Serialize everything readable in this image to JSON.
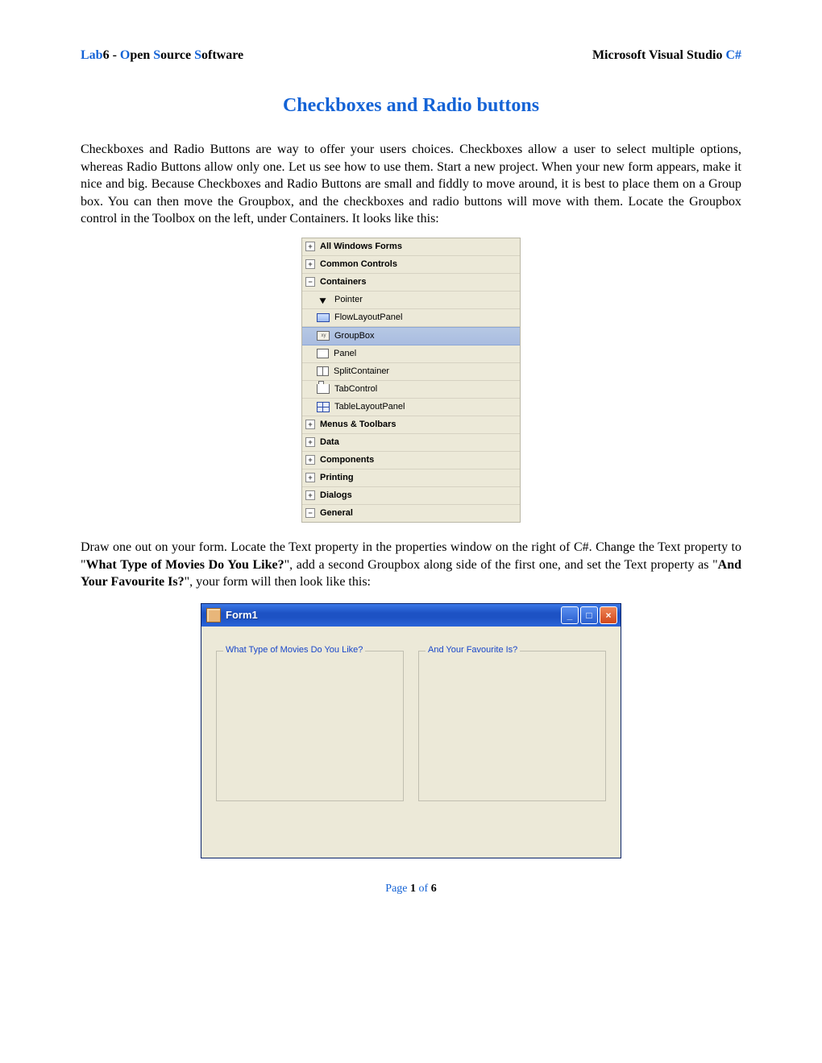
{
  "header": {
    "left_lab": "Lab",
    "left_six": "6 - ",
    "left_o": "O",
    "left_open": "pen ",
    "left_s1": "S",
    "left_source": "ource ",
    "left_s2": "S",
    "left_software": "oftware",
    "right_pre": "Microsoft Visual Studio ",
    "right_c": "C#"
  },
  "title": "Checkboxes and Radio buttons",
  "para1": "Checkboxes and Radio Buttons are way to offer your users choices. Checkboxes allow a user to select multiple options, whereas Radio Buttons allow only one. Let us see how to use them. Start a new project. When your new form appears, make it nice and big. Because Checkboxes and Radio Buttons are small and fiddly to move around, it is best to place them on a Group box. You can then move the Groupbox, and the checkboxes and radio buttons will move with them. Locate the Groupbox control in the Toolbox on the left, under Containers. It looks like this:",
  "toolbox": {
    "cats_top": [
      {
        "label": "All Windows Forms",
        "expand": "+"
      },
      {
        "label": "Common Controls",
        "expand": "+"
      },
      {
        "label": "Containers",
        "expand": "−"
      }
    ],
    "items": [
      {
        "label": "Pointer",
        "icon": "pointer"
      },
      {
        "label": "FlowLayoutPanel",
        "icon": "flow"
      },
      {
        "label": "GroupBox",
        "icon": "gbox",
        "selected": true
      },
      {
        "label": "Panel",
        "icon": "panel"
      },
      {
        "label": "SplitContainer",
        "icon": "split"
      },
      {
        "label": "TabControl",
        "icon": "tab"
      },
      {
        "label": "TableLayoutPanel",
        "icon": "tlp"
      }
    ],
    "cats_bottom": [
      {
        "label": "Menus & Toolbars",
        "expand": "+"
      },
      {
        "label": "Data",
        "expand": "+"
      },
      {
        "label": "Components",
        "expand": "+"
      },
      {
        "label": "Printing",
        "expand": "+"
      },
      {
        "label": "Dialogs",
        "expand": "+"
      },
      {
        "label": "General",
        "expand": "−"
      }
    ]
  },
  "para2_a": "Draw one out on your form. Locate the Text property in the properties window on the right of C#. Change the Text property to \"",
  "para2_b": "What Type of Movies Do You Like?",
  "para2_c": "\", add a second Groupbox along side of the first one, and set the Text property as \"",
  "para2_d": "And Your Favourite Is?",
  "para2_e": "\", your form will then look like this:",
  "form": {
    "title": "Form1",
    "min": "_",
    "max": "□",
    "close": "×",
    "group1": "What Type of Movies Do You Like?",
    "group2": "And Your Favourite Is?"
  },
  "footer": {
    "page_word": "Page ",
    "page_num": "1",
    "of_word": " of ",
    "total": "6"
  }
}
